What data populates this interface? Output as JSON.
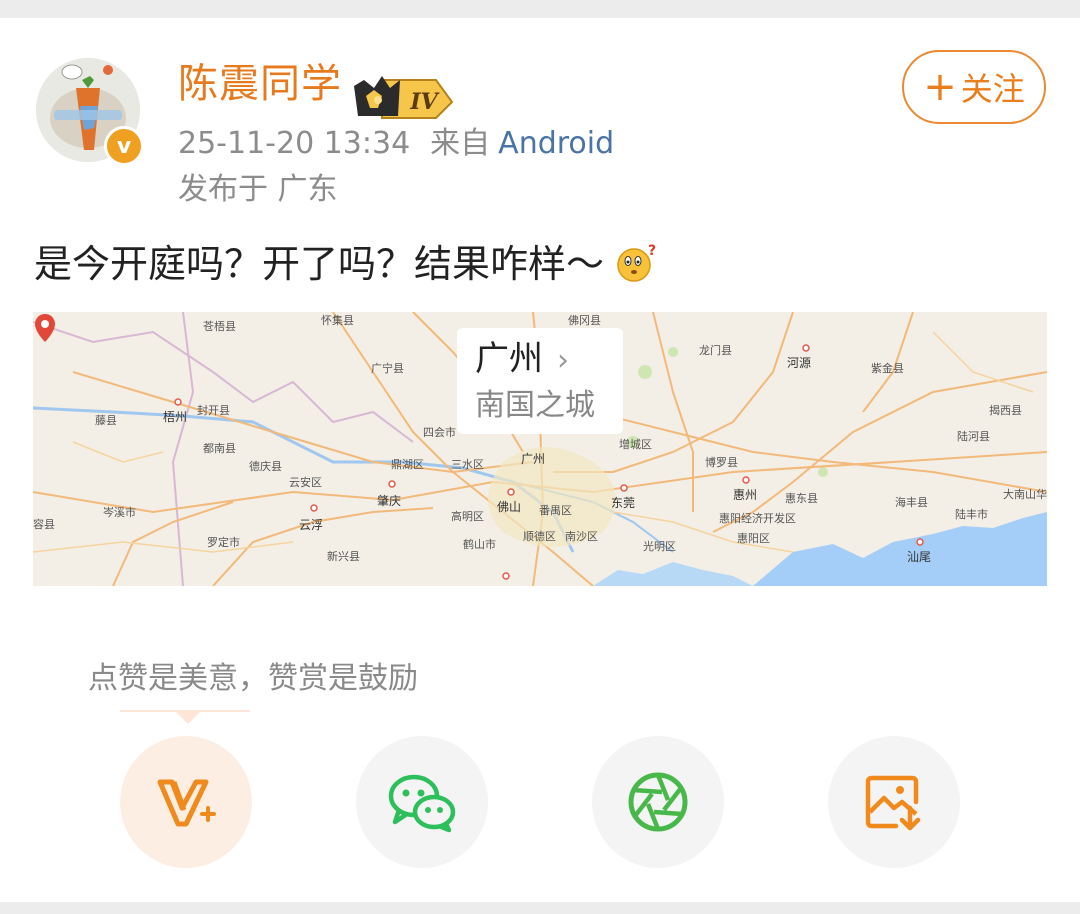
{
  "post": {
    "username": "陈震同学",
    "rank_badge": "IV",
    "verified_badge": "v",
    "timestamp": "25-11-20 13:34",
    "from_label": "来自",
    "source": "Android",
    "location": "发布于 广东",
    "follow_label": "关注",
    "follow_plus": "+",
    "text": "是今开庭吗？开了吗？结果咋样～",
    "emoji": "thinking-face"
  },
  "map": {
    "city": "广州",
    "chevron": "›",
    "subtitle": "南国之城",
    "place_labels": [
      "苍梧县",
      "怀集县",
      "广宁县",
      "佛冈县",
      "龙门县",
      "河源",
      "紫金县",
      "梧州",
      "封开县",
      "藤县",
      "都南县",
      "德庆县",
      "云安区",
      "四会市",
      "鼎湖区",
      "三水区",
      "广州",
      "增城区",
      "博罗县",
      "惠州",
      "揭西县",
      "陆河县",
      "肇庆",
      "云浮",
      "佛山",
      "高明区",
      "番禺区",
      "东莞",
      "惠阳经济开发区",
      "惠东县",
      "海丰县",
      "陆丰市",
      "大南山华",
      "岑溪市",
      "罗定市",
      "新兴县",
      "鹤山市",
      "顺德区",
      "南沙区",
      "光明区",
      "惠阳区",
      "汕尾",
      "容县"
    ]
  },
  "actions": {
    "tip": "点赞是美意，赞赏是鼓励",
    "buttons": [
      "reward-icon",
      "wechat-icon",
      "moments-icon",
      "save-image-icon"
    ]
  },
  "colors": {
    "accent": "#e87a1e",
    "link": "#4a73a6",
    "muted": "#8c8c8c",
    "wechat_green": "#2dbf5c",
    "sea_blue": "#a4cdf7"
  }
}
